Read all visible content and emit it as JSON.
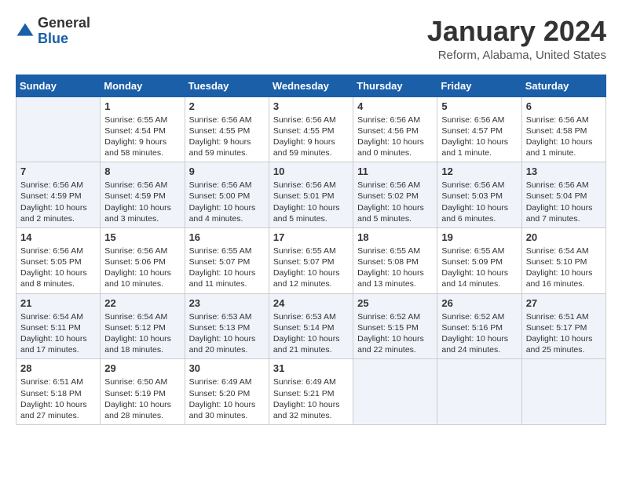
{
  "header": {
    "logo_general": "General",
    "logo_blue": "Blue",
    "month_title": "January 2024",
    "location": "Reform, Alabama, United States"
  },
  "weekdays": [
    "Sunday",
    "Monday",
    "Tuesday",
    "Wednesday",
    "Thursday",
    "Friday",
    "Saturday"
  ],
  "weeks": [
    [
      {
        "day": "",
        "info": ""
      },
      {
        "day": "1",
        "info": "Sunrise: 6:55 AM\nSunset: 4:54 PM\nDaylight: 9 hours\nand 58 minutes."
      },
      {
        "day": "2",
        "info": "Sunrise: 6:56 AM\nSunset: 4:55 PM\nDaylight: 9 hours\nand 59 minutes."
      },
      {
        "day": "3",
        "info": "Sunrise: 6:56 AM\nSunset: 4:55 PM\nDaylight: 9 hours\nand 59 minutes."
      },
      {
        "day": "4",
        "info": "Sunrise: 6:56 AM\nSunset: 4:56 PM\nDaylight: 10 hours\nand 0 minutes."
      },
      {
        "day": "5",
        "info": "Sunrise: 6:56 AM\nSunset: 4:57 PM\nDaylight: 10 hours\nand 1 minute."
      },
      {
        "day": "6",
        "info": "Sunrise: 6:56 AM\nSunset: 4:58 PM\nDaylight: 10 hours\nand 1 minute."
      }
    ],
    [
      {
        "day": "7",
        "info": "Sunrise: 6:56 AM\nSunset: 4:59 PM\nDaylight: 10 hours\nand 2 minutes."
      },
      {
        "day": "8",
        "info": "Sunrise: 6:56 AM\nSunset: 4:59 PM\nDaylight: 10 hours\nand 3 minutes."
      },
      {
        "day": "9",
        "info": "Sunrise: 6:56 AM\nSunset: 5:00 PM\nDaylight: 10 hours\nand 4 minutes."
      },
      {
        "day": "10",
        "info": "Sunrise: 6:56 AM\nSunset: 5:01 PM\nDaylight: 10 hours\nand 5 minutes."
      },
      {
        "day": "11",
        "info": "Sunrise: 6:56 AM\nSunset: 5:02 PM\nDaylight: 10 hours\nand 5 minutes."
      },
      {
        "day": "12",
        "info": "Sunrise: 6:56 AM\nSunset: 5:03 PM\nDaylight: 10 hours\nand 6 minutes."
      },
      {
        "day": "13",
        "info": "Sunrise: 6:56 AM\nSunset: 5:04 PM\nDaylight: 10 hours\nand 7 minutes."
      }
    ],
    [
      {
        "day": "14",
        "info": "Sunrise: 6:56 AM\nSunset: 5:05 PM\nDaylight: 10 hours\nand 8 minutes."
      },
      {
        "day": "15",
        "info": "Sunrise: 6:56 AM\nSunset: 5:06 PM\nDaylight: 10 hours\nand 10 minutes."
      },
      {
        "day": "16",
        "info": "Sunrise: 6:55 AM\nSunset: 5:07 PM\nDaylight: 10 hours\nand 11 minutes."
      },
      {
        "day": "17",
        "info": "Sunrise: 6:55 AM\nSunset: 5:07 PM\nDaylight: 10 hours\nand 12 minutes."
      },
      {
        "day": "18",
        "info": "Sunrise: 6:55 AM\nSunset: 5:08 PM\nDaylight: 10 hours\nand 13 minutes."
      },
      {
        "day": "19",
        "info": "Sunrise: 6:55 AM\nSunset: 5:09 PM\nDaylight: 10 hours\nand 14 minutes."
      },
      {
        "day": "20",
        "info": "Sunrise: 6:54 AM\nSunset: 5:10 PM\nDaylight: 10 hours\nand 16 minutes."
      }
    ],
    [
      {
        "day": "21",
        "info": "Sunrise: 6:54 AM\nSunset: 5:11 PM\nDaylight: 10 hours\nand 17 minutes."
      },
      {
        "day": "22",
        "info": "Sunrise: 6:54 AM\nSunset: 5:12 PM\nDaylight: 10 hours\nand 18 minutes."
      },
      {
        "day": "23",
        "info": "Sunrise: 6:53 AM\nSunset: 5:13 PM\nDaylight: 10 hours\nand 20 minutes."
      },
      {
        "day": "24",
        "info": "Sunrise: 6:53 AM\nSunset: 5:14 PM\nDaylight: 10 hours\nand 21 minutes."
      },
      {
        "day": "25",
        "info": "Sunrise: 6:52 AM\nSunset: 5:15 PM\nDaylight: 10 hours\nand 22 minutes."
      },
      {
        "day": "26",
        "info": "Sunrise: 6:52 AM\nSunset: 5:16 PM\nDaylight: 10 hours\nand 24 minutes."
      },
      {
        "day": "27",
        "info": "Sunrise: 6:51 AM\nSunset: 5:17 PM\nDaylight: 10 hours\nand 25 minutes."
      }
    ],
    [
      {
        "day": "28",
        "info": "Sunrise: 6:51 AM\nSunset: 5:18 PM\nDaylight: 10 hours\nand 27 minutes."
      },
      {
        "day": "29",
        "info": "Sunrise: 6:50 AM\nSunset: 5:19 PM\nDaylight: 10 hours\nand 28 minutes."
      },
      {
        "day": "30",
        "info": "Sunrise: 6:49 AM\nSunset: 5:20 PM\nDaylight: 10 hours\nand 30 minutes."
      },
      {
        "day": "31",
        "info": "Sunrise: 6:49 AM\nSunset: 5:21 PM\nDaylight: 10 hours\nand 32 minutes."
      },
      {
        "day": "",
        "info": ""
      },
      {
        "day": "",
        "info": ""
      },
      {
        "day": "",
        "info": ""
      }
    ]
  ]
}
